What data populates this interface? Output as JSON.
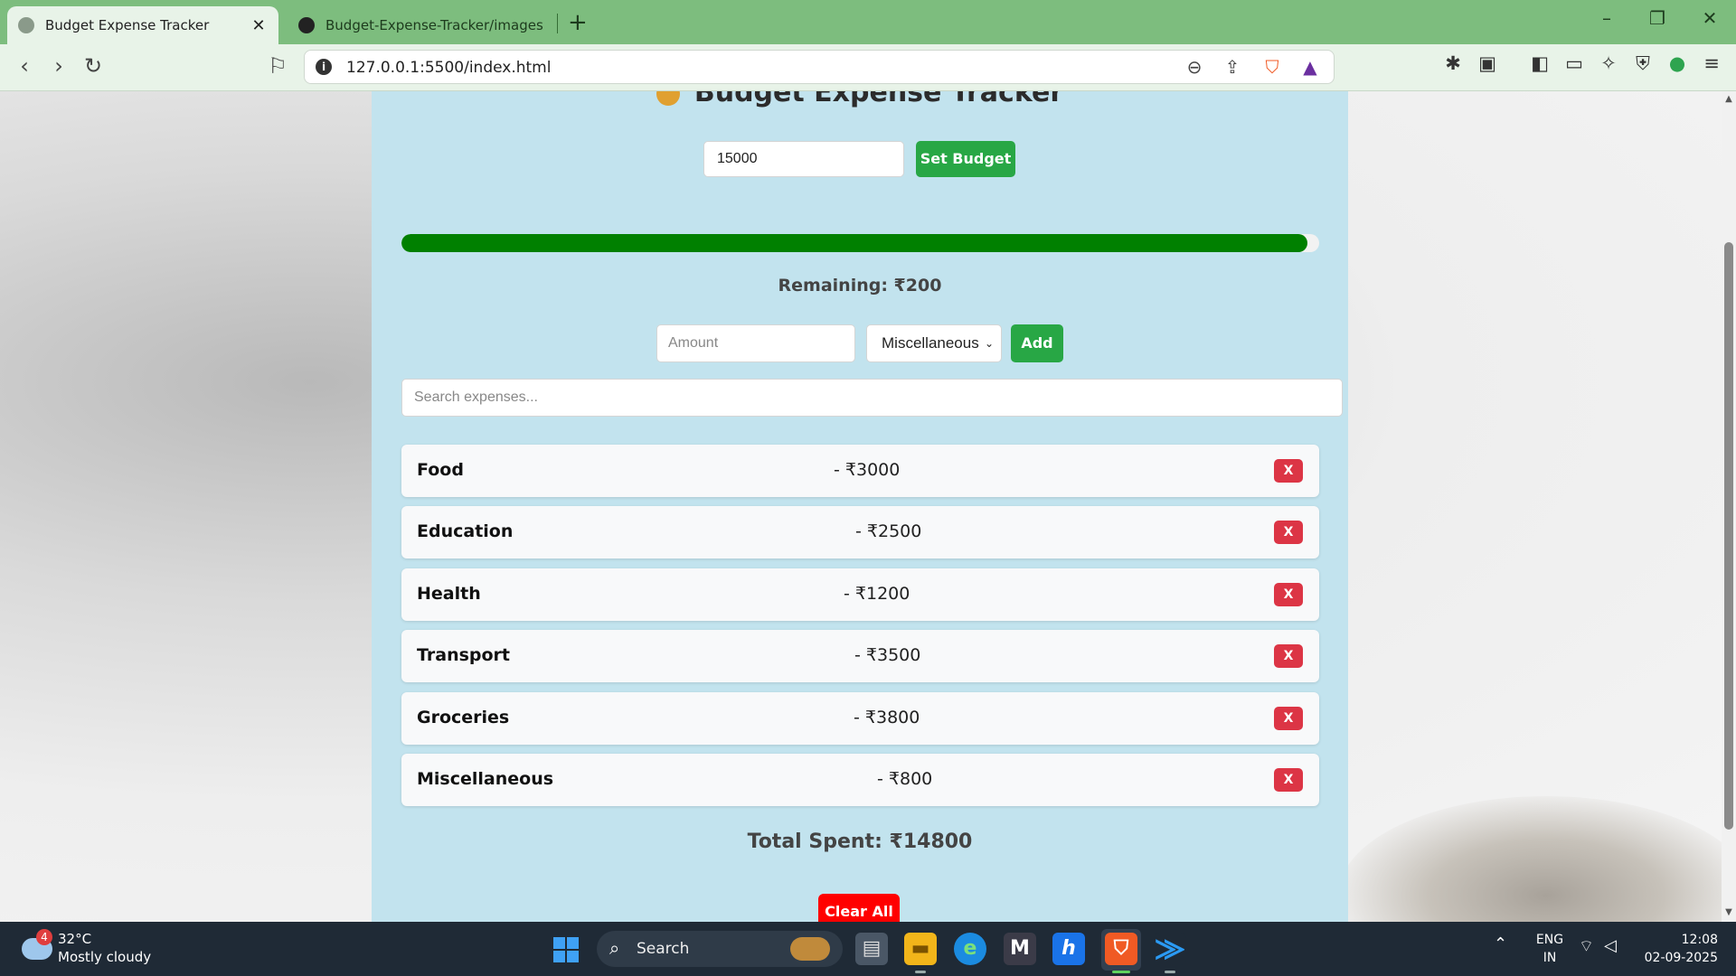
{
  "browser": {
    "tabs": [
      {
        "title": "Budget Expense Tracker",
        "active": true
      },
      {
        "title": "Budget-Expense-Tracker/images at m",
        "active": false
      }
    ],
    "url": "127.0.0.1:5500/index.html"
  },
  "app": {
    "title": "Budget Expense Tracker",
    "budget_value": "15000",
    "set_budget_label": "Set Budget",
    "progress_fraction": 0.987,
    "remaining_text": "Remaining: ₹200",
    "amount_placeholder": "Amount",
    "category_selected": "Miscellaneous",
    "add_label": "Add",
    "search_placeholder": "Search expenses...",
    "expenses": [
      {
        "category": "Food",
        "amount": "- ₹3000"
      },
      {
        "category": "Education",
        "amount": "- ₹2500"
      },
      {
        "category": "Health",
        "amount": "- ₹1200"
      },
      {
        "category": "Transport",
        "amount": "- ₹3500"
      },
      {
        "category": "Groceries",
        "amount": "- ₹3800"
      },
      {
        "category": "Miscellaneous",
        "amount": "- ₹800"
      }
    ],
    "delete_label": "X",
    "total_text": "Total Spent: ₹14800",
    "clear_label": "Clear All"
  },
  "taskbar": {
    "weather_badge": "4",
    "weather_temp": "32°C",
    "weather_desc": "Mostly cloudy",
    "search_label": "Search",
    "lang_line1": "ENG",
    "lang_line2": "IN",
    "time": "12:08",
    "date": "02-09-2025"
  },
  "colors": {
    "tabbar": "#7dbd7e",
    "panel": "#c2e3ee",
    "progress": "#008000",
    "primary_button": "#28a745",
    "delete_button": "#dc3545",
    "clear_button": "#ff0000"
  }
}
